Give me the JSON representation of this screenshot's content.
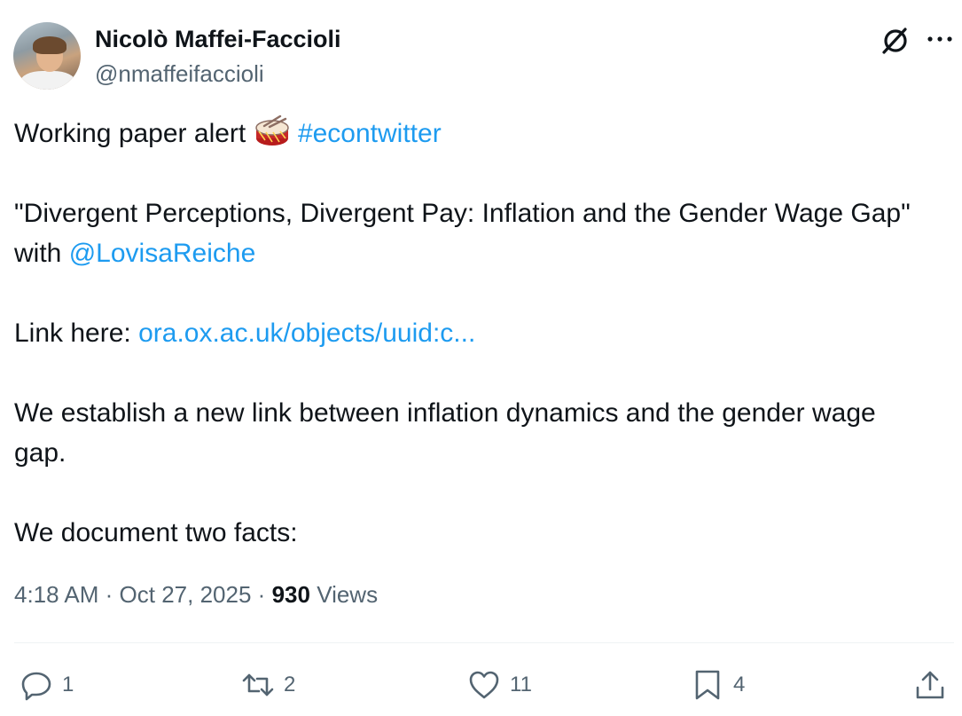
{
  "author": {
    "display_name": "Nicolò Maffei-Faccioli",
    "handle": "@nmaffeifaccioli"
  },
  "tweet": {
    "line1_text": "Working paper alert",
    "line1_emoji": "drum-emoji",
    "hashtag": "#econtwitter",
    "title_line": "\"Divergent Perceptions, Divergent Pay: Inflation and the Gender Wage Gap\"",
    "with_text": "with",
    "mention": "@LovisaReiche",
    "link_label": "Link here:",
    "link": "ora.ox.ac.uk/objects/uuid:c...",
    "para_line1": "We establish a new link between inflation dynamics and the gender wage",
    "para_line2": "gap.",
    "para_last": "We document two facts:"
  },
  "meta": {
    "time": "4:18 AM",
    "separator": "·",
    "date": "Oct 27, 2025",
    "views_count": "930",
    "views_label": "Views"
  },
  "actions": {
    "replies": "1",
    "reposts": "2",
    "likes": "11",
    "bookmarks": "4"
  },
  "icons": {
    "header": [
      "grok-icon",
      "more-icon"
    ],
    "actions": [
      "reply-icon",
      "repost-icon",
      "like-icon",
      "bookmark-icon",
      "share-icon"
    ]
  },
  "colors": {
    "text": "#0f1419",
    "secondary": "#536471",
    "link": "#1d9bf0",
    "divider": "#eff3f4"
  }
}
